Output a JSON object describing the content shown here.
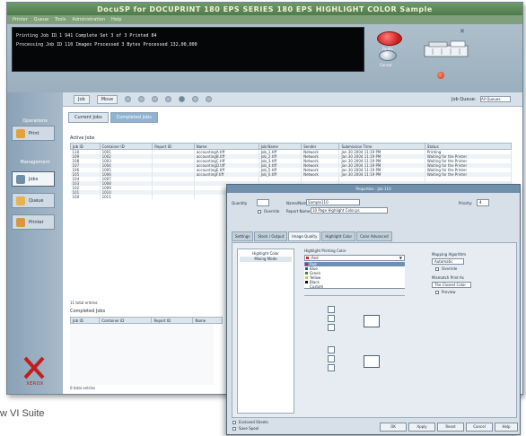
{
  "window": {
    "title": "DocuSP for DOCUPRINT 180 EPS SERIES 180 EPS HIGHLIGHT COLOR Sample",
    "menu": [
      "Printer",
      "Queue",
      "Tools",
      "Administration",
      "Help"
    ]
  },
  "status": {
    "line1": "Printing   Job ID 1   941 Complete   Set 3 of 3   Printed 84",
    "line2": "Processing   Job ID 110   Images Processed 3   Bytes Processed 132,00,000",
    "alert_label": "Faults",
    "cancel_label": "Cancel"
  },
  "sidebar": {
    "sections": [
      "Operations",
      "Management"
    ],
    "items": [
      {
        "label": "Print",
        "icon": "print-icon"
      },
      {
        "label": "Jobs",
        "icon": "jobs-icon"
      },
      {
        "label": "Queue",
        "icon": "queue-icon"
      },
      {
        "label": "Printer",
        "icon": "printer-icon"
      }
    ],
    "logo_text": "XEROX"
  },
  "toolbar": {
    "buttons": [
      "Job",
      "Move"
    ],
    "filter_label": "Job Queue:",
    "filter_value": "All Queues"
  },
  "tabs": [
    "Current Jobs",
    "Completed Jobs"
  ],
  "active_jobs": {
    "label": "Active Jobs",
    "headers": [
      "Job ID",
      "Container ID",
      "Report ID",
      "Name",
      "Job Name",
      "Sender",
      "Submission Time",
      "Status"
    ],
    "rows": [
      [
        "110",
        "1001",
        "",
        "accountingA.tiff",
        "Job_1.tiff",
        "Network",
        "Jan 30 2004 11:19 PM",
        "Printing"
      ],
      [
        "109",
        "1002",
        "",
        "accountingB.tiff",
        "Job_2.tiff",
        "Network",
        "Jan 30 2004 11:19 PM",
        "Waiting for the Printer"
      ],
      [
        "108",
        "1003",
        "",
        "accountingC.tiff",
        "Job_3.tiff",
        "Network",
        "Jan 30 2004 11:19 PM",
        "Waiting for the Printer"
      ],
      [
        "107",
        "1004",
        "",
        "accountingD.tiff",
        "Job_4.tiff",
        "Network",
        "Jan 30 2004 11:19 PM",
        "Waiting for the Printer"
      ],
      [
        "106",
        "1005",
        "",
        "accountingE.tiff",
        "Job_5.tiff",
        "Network",
        "Jan 30 2004 11:19 PM",
        "Waiting for the Printer"
      ],
      [
        "105",
        "1006",
        "",
        "accountingF.tiff",
        "Job_6.tiff",
        "Network",
        "Jan 30 2004 11:19 PM",
        "Waiting for the Printer"
      ],
      [
        "104",
        "1007",
        "",
        "",
        "",
        "",
        "",
        ""
      ],
      [
        "103",
        "1008",
        "",
        "",
        "",
        "",
        "",
        ""
      ],
      [
        "102",
        "1009",
        "",
        "",
        "",
        "",
        "",
        ""
      ],
      [
        "101",
        "1010",
        "",
        "",
        "",
        "",
        "",
        ""
      ],
      [
        "100",
        "1011",
        "",
        "",
        "",
        "",
        "",
        ""
      ]
    ],
    "count": "11 total entries"
  },
  "completed_jobs": {
    "label": "Completed Jobs",
    "headers": [
      "Job ID",
      "Container ID",
      "Report ID",
      "Name"
    ],
    "count": "0 total entries"
  },
  "dialog": {
    "title": "Properties - Job 110",
    "quantity_label": "Quantity",
    "override_label": "Override",
    "name_label": "Name/Name:",
    "name_value": "Sample110",
    "report_label": "Report Name:",
    "report_value": "10 Page Highlight Color.ps",
    "priority_label": "Priority:",
    "priority_value": "4",
    "tabs": [
      "Settings",
      "Stock / Output",
      "Image Quality",
      "Highlight Color",
      "Color Advanced"
    ],
    "list_header": "Highlight Color",
    "list_item": "Mixing Mode",
    "printing_label": "Highlight Printing Color",
    "dropdown_value": "Red",
    "menu_items": [
      "Red",
      "Blue",
      "Green",
      "Yellow",
      "Black",
      "Custom"
    ],
    "mapping_label": "Mapping Algorithm",
    "mapping_value": "Automatic",
    "override_opt": "Override",
    "print_as_label": "Mismatch Print As",
    "print_as_value": "The Closest Color",
    "preview_label": "Preview",
    "footer_left": [
      "Enclosed Sheets",
      "Save Spool"
    ],
    "buttons": [
      "OK",
      "Apply",
      "Reset",
      "Cancel",
      "Help"
    ]
  },
  "caption": "w VI Suite"
}
